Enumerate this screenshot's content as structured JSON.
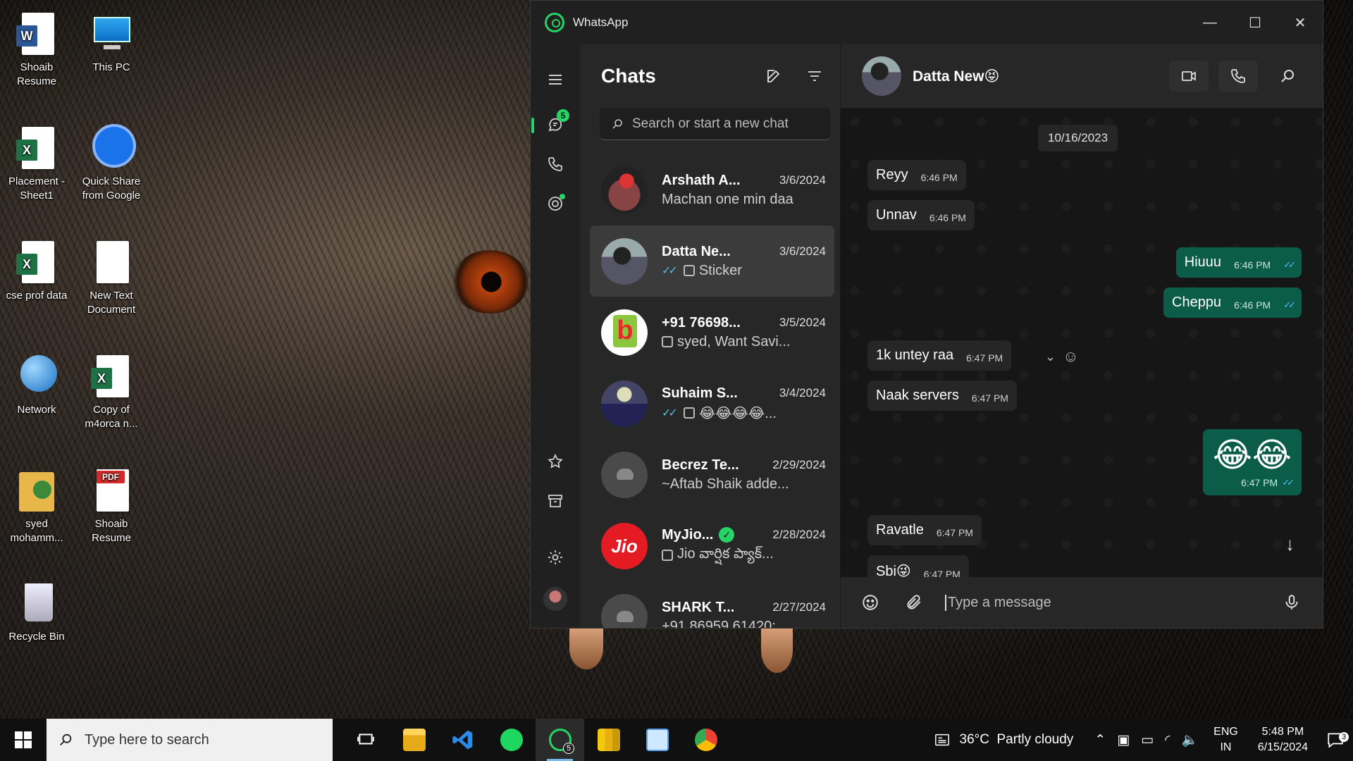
{
  "desktop": {
    "icons": [
      {
        "label": "Shoaib\nResume"
      },
      {
        "label": "This PC"
      },
      {
        "label": "Placement -\nSheet1"
      },
      {
        "label": "Quick Share\nfrom Google"
      },
      {
        "label": "cse prof data"
      },
      {
        "label": "New Text\nDocument"
      },
      {
        "label": "Network"
      },
      {
        "label": "Copy of\nm4orca n..."
      },
      {
        "label": "syed\nmohamm..."
      },
      {
        "label": "Shoaib\nResume"
      },
      {
        "label": "Recycle Bin"
      }
    ]
  },
  "window": {
    "title": "WhatsApp",
    "controls": {
      "minimize": "—",
      "maximize": "☐",
      "close": "✕"
    }
  },
  "rail": {
    "chats_badge": "5"
  },
  "chat_list": {
    "title": "Chats",
    "search_placeholder": "Search or start a new chat",
    "items": [
      {
        "name": "Arshath A...",
        "date": "3/6/2024",
        "preview": "Machan one min daa"
      },
      {
        "name": "Datta Ne...",
        "date": "3/6/2024",
        "preview": "Sticker"
      },
      {
        "name": "+91 76698...",
        "date": "3/5/2024",
        "preview": "syed, Want Savi..."
      },
      {
        "name": "Suhaim S...",
        "date": "3/4/2024",
        "preview": "😂😂😂😂..."
      },
      {
        "name": "Becrez Te...",
        "date": "2/29/2024",
        "preview": "~Aftab Shaik adde..."
      },
      {
        "name": "MyJio...",
        "date": "2/28/2024",
        "preview": "Jio వార్షిక ప్యాక్..."
      },
      {
        "name": "SHARK T...",
        "date": "2/27/2024",
        "preview": "+91 86959 61420:..."
      }
    ],
    "jio_label": "Jio"
  },
  "conversation": {
    "name": "Datta New😝",
    "date_chip": "10/16/2023",
    "messages": [
      {
        "text": "Reyy",
        "time": "6:46 PM"
      },
      {
        "text": "Unnav",
        "time": "6:46 PM"
      },
      {
        "text": "Hiuuu",
        "time": "6:46 PM"
      },
      {
        "text": "Cheppu",
        "time": "6:46 PM"
      },
      {
        "text": "1k untey raa",
        "time": "6:47 PM"
      },
      {
        "text": "Naak servers",
        "time": "6:47 PM"
      },
      {
        "text": "😂😂",
        "time": "6:47 PM"
      },
      {
        "text": "Ravatle",
        "time": "6:47 PM"
      },
      {
        "text": "Sbi😜",
        "time": "6:47 PM"
      }
    ],
    "composer_placeholder": "Type a message"
  },
  "taskbar": {
    "search_placeholder": "Type here to search",
    "whatsapp_badge": "5",
    "weather": "36°C  Partly cloudy",
    "lang_top": "ENG",
    "lang_bottom": "IN",
    "time": "5:48 PM",
    "date": "6/15/2024",
    "notifications": "3"
  }
}
